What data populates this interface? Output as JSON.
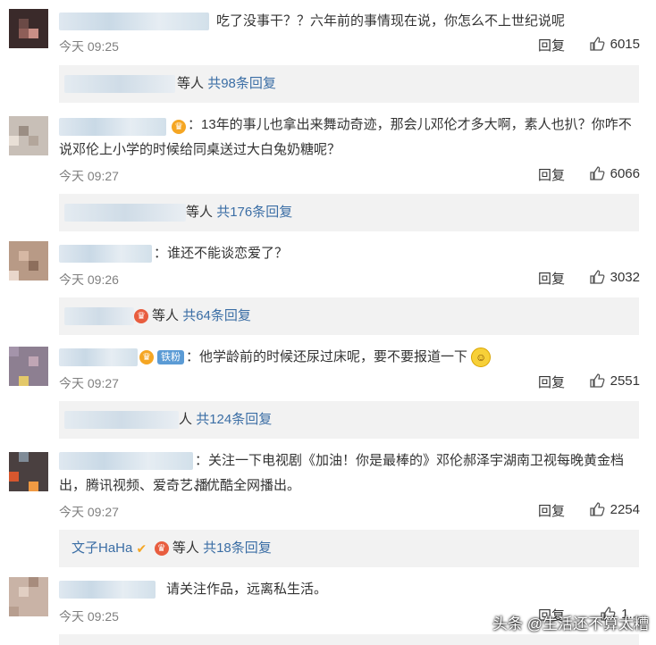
{
  "labels": {
    "reply": "回复"
  },
  "comments": [
    {
      "text": "吃了没事干？？六年前的事情现在说，你怎么不上世纪说呢",
      "time": "09:25",
      "likes": "6015",
      "replies": {
        "names": "等人",
        "count": "共98条回复"
      }
    },
    {
      "text1": "：13年的事儿也拿出来舞动奇迹，那会儿邓伦才多大啊，素人也扒？你咋不",
      "text2": "说邓伦上小学的时候给同桌送过大白兔奶糖呢？",
      "time": "今天 09:27",
      "likes": "6066",
      "replies": {
        "names": "等人",
        "count": "共176条回复"
      }
    },
    {
      "text": "：谁还不能谈恋爱了？",
      "time": "今天 09:26",
      "likes": "3032",
      "replies": {
        "names": "等人",
        "count": "共64条回复"
      }
    },
    {
      "badge": "铁粉",
      "text": "：他学龄前的时候还尿过床呢，要不要报道一下",
      "time": "今天 09:27",
      "likes": "2551",
      "replies": {
        "names": "人",
        "count": "共124条回复"
      }
    },
    {
      "text1": "：关注一下电视剧《加油！你是最棒的》邓伦郝泽宇湖南卫视每晚黄金档播",
      "text2": "出，腾讯视频、爱奇艺、优酷全网播出。",
      "time": "今天 09:27",
      "likes": "2254",
      "replies": {
        "user": "文子HaHa",
        "names": "等人",
        "count": "共18条回复"
      }
    },
    {
      "text": "请关注作品，远离私生活。",
      "time": "今天 09:25",
      "likes": "1..."
    }
  ],
  "watermark": "头条 @生活还不算太糟"
}
